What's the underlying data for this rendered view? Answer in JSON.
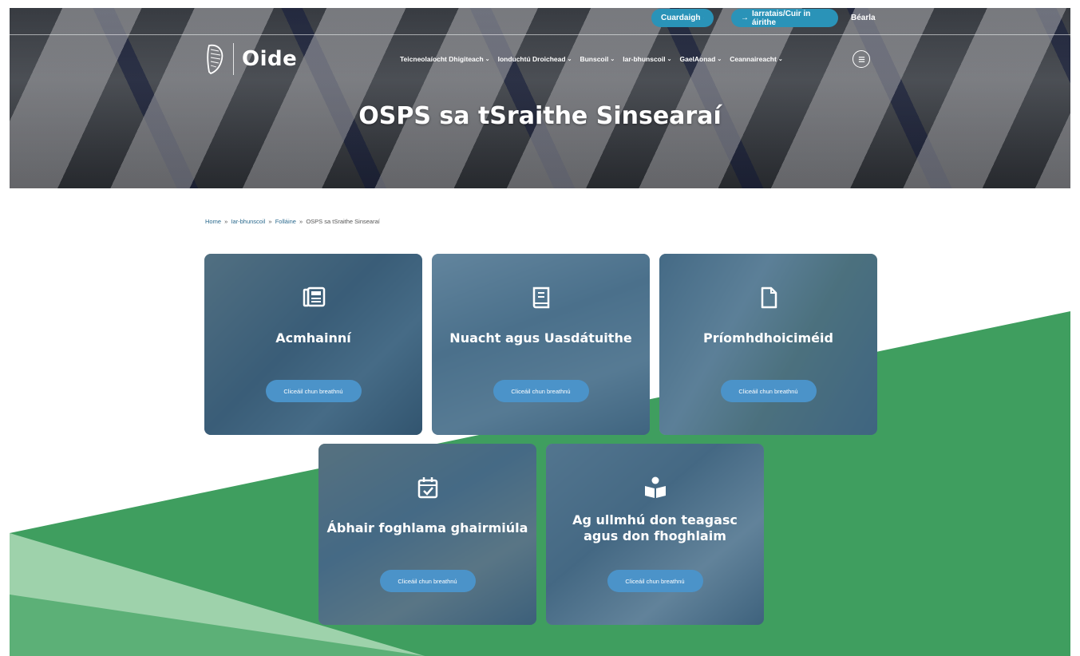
{
  "header": {
    "search_label": "Cuardaigh",
    "requests_label": "Iarratais/Cuir in áirithe",
    "language_label": "Béarla",
    "brand": "Oide",
    "nav": [
      {
        "label": "Teicneolaíocht Dhigiteach",
        "chevron": "⌄"
      },
      {
        "label": "Ionduchtú Droichead",
        "chevron": "⌄"
      },
      {
        "label": "Bunscoil",
        "chevron": "⌄"
      },
      {
        "label": "Iar-bhunscoil",
        "chevron": "⌄"
      },
      {
        "label": "GaelAonad",
        "chevron": "⌄"
      },
      {
        "label": "Ceannaireacht",
        "chevron": "⌄"
      }
    ],
    "page_title": "OSPS sa tSraithe Sinsearaí"
  },
  "breadcrumb": {
    "items": [
      "Home",
      "Iar-bhunscoil",
      "Folláine"
    ],
    "separator": "»",
    "current": "OSPS sa tSraithe Sinsearaí"
  },
  "cards": [
    {
      "title": "Acmhainní",
      "button": "Cliceáil chun breathnú",
      "icon": "newspaper-icon"
    },
    {
      "title": "Nuacht agus Uasdátuithe",
      "button": "Cliceáil chun breathnú",
      "icon": "book-icon"
    },
    {
      "title": "Príomhdhoiciméid",
      "button": "Cliceáil chun breathnú",
      "icon": "document-icon"
    },
    {
      "title": "Ábhair foghlama ghairmiúla",
      "button": "Cliceáil chun breathnú",
      "icon": "calendar-check-icon"
    },
    {
      "title": "Ag ullmhú don teagasc agus don fhoghlaim",
      "button": "Cliceáil chun breathnú",
      "icon": "reader-icon"
    }
  ],
  "colors": {
    "accent_blue": "#2a93b8",
    "button_blue": "#4b93c9",
    "green_dark": "#3f9e5f",
    "green_light": "#a9d7b4"
  }
}
